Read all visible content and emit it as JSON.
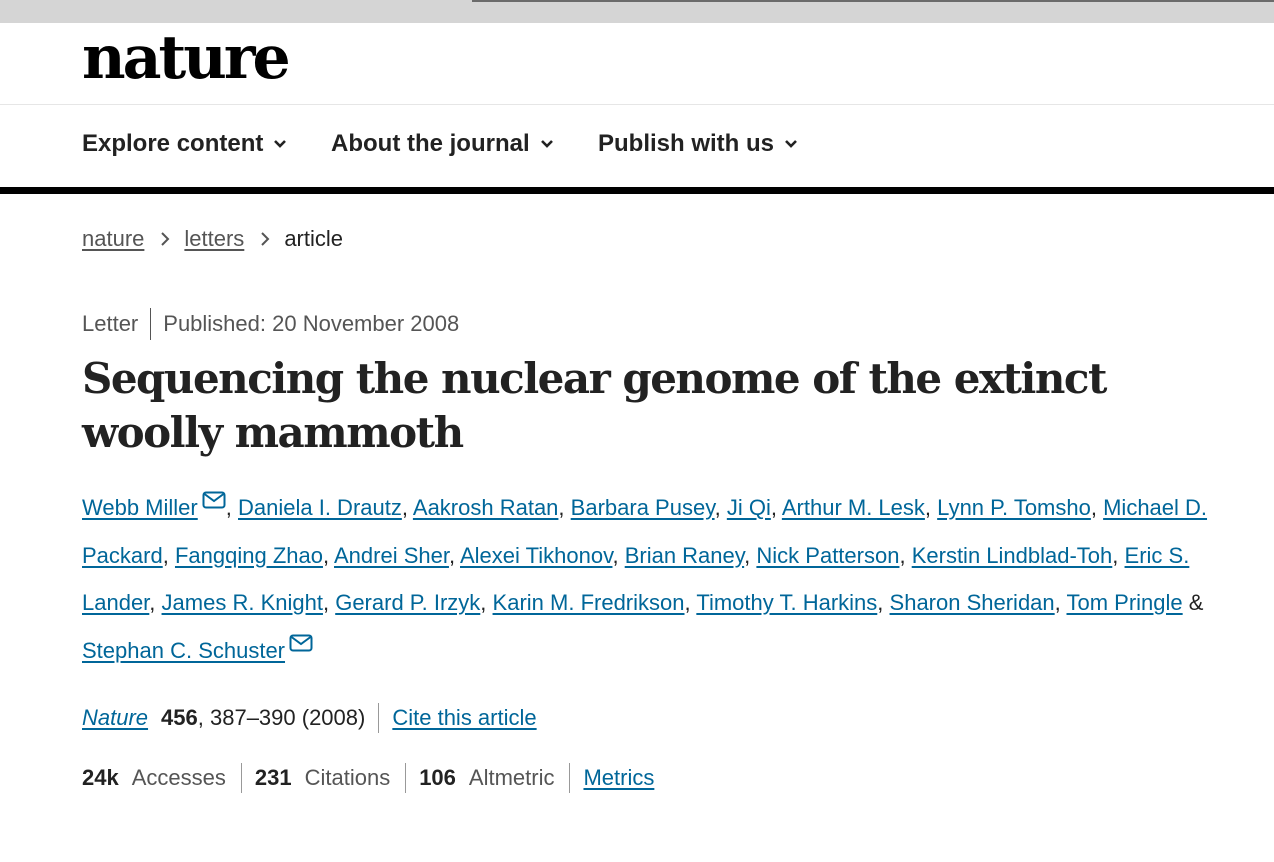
{
  "brand": {
    "logo_text": "nature"
  },
  "nav": {
    "items": [
      {
        "label": "Explore content"
      },
      {
        "label": "About the journal"
      },
      {
        "label": "Publish with us"
      }
    ]
  },
  "breadcrumb": {
    "items": [
      "nature",
      "letters",
      "article"
    ]
  },
  "article": {
    "type": "Letter",
    "published": "Published: 20 November 2008",
    "title": "Sequencing the nuclear genome of the extinct woolly mammoth",
    "authors": [
      "Webb Miller",
      "Daniela I. Drautz",
      "Aakrosh Ratan",
      "Barbara Pusey",
      "Ji Qi",
      "Arthur M. Lesk",
      "Lynn P. Tomsho",
      "Michael D. Packard",
      "Fangqing Zhao",
      "Andrei Sher",
      "Alexei Tikhonov",
      "Brian Raney",
      "Nick Patterson",
      "Kerstin Lindblad-Toh",
      "Eric S. Lander",
      "James R. Knight",
      "Gerard P. Irzyk",
      "Karin M. Fredrikson",
      "Timothy T. Harkins",
      "Sharon Sheridan",
      "Tom Pringle",
      "Stephan C. Schuster"
    ],
    "separators": {
      "comma": ",",
      "ampersand": "&"
    },
    "icons": {
      "corresponding_author": "mail-icon"
    }
  },
  "citation": {
    "journal": "Nature",
    "volume": "456",
    "pages_year": ", 387–390 (2008)",
    "cite_link": "Cite this article"
  },
  "metrics": {
    "accesses_value": "24k",
    "accesses_label": "Accesses",
    "citations_value": "231",
    "citations_label": "Citations",
    "altmetric_value": "106",
    "altmetric_label": "Altmetric",
    "metrics_link": "Metrics"
  },
  "colors": {
    "link": "#006699",
    "text": "#222222",
    "muted": "#555555",
    "rule": "#000000"
  }
}
